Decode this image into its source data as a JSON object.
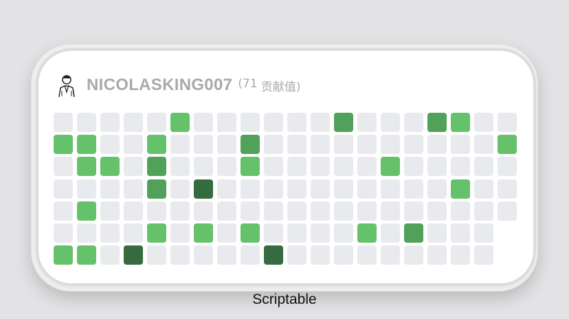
{
  "widget": {
    "username": "NICOLASKING007",
    "contribution_open": "(",
    "contribution_count": "71",
    "contribution_label": " 贡献值)"
  },
  "caption": "Scriptable",
  "colors": {
    "empty": "#e9eaee",
    "level_1": "#66c26a",
    "level_2": "#52a15b",
    "level_3": "#366b40"
  },
  "contribution_grid": {
    "rows": 7,
    "columns": 20,
    "levels": [
      [
        0,
        0,
        0,
        0,
        0,
        1,
        0,
        0,
        0,
        0,
        0,
        0,
        2,
        0,
        0,
        0,
        2,
        1,
        0,
        0
      ],
      [
        1,
        1,
        0,
        0,
        1,
        0,
        0,
        0,
        2,
        0,
        0,
        0,
        0,
        0,
        0,
        0,
        0,
        0,
        0,
        1
      ],
      [
        0,
        1,
        1,
        0,
        2,
        0,
        0,
        0,
        1,
        0,
        0,
        0,
        0,
        0,
        1,
        0,
        0,
        0,
        0,
        0
      ],
      [
        0,
        0,
        0,
        0,
        2,
        0,
        3,
        0,
        0,
        0,
        0,
        0,
        0,
        0,
        0,
        0,
        0,
        1,
        0,
        0
      ],
      [
        0,
        1,
        0,
        0,
        0,
        0,
        0,
        0,
        0,
        0,
        0,
        0,
        0,
        0,
        0,
        0,
        0,
        0,
        0,
        0
      ],
      [
        0,
        0,
        0,
        0,
        1,
        0,
        1,
        0,
        1,
        0,
        0,
        0,
        0,
        1,
        0,
        2,
        0,
        0,
        0,
        null
      ],
      [
        1,
        1,
        0,
        3,
        0,
        0,
        0,
        0,
        0,
        3,
        0,
        0,
        0,
        0,
        0,
        0,
        0,
        0,
        0,
        null
      ]
    ]
  }
}
